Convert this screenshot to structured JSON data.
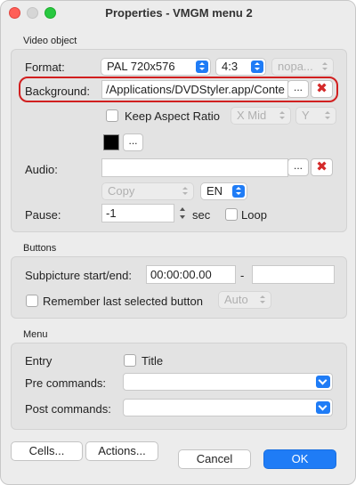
{
  "window": {
    "title": "Properties - VMGM menu 2"
  },
  "video_object": {
    "group_label": "Video object",
    "format": {
      "label": "Format:",
      "value": "PAL 720x576",
      "aspect": "4:3",
      "pan": "nopa..."
    },
    "background": {
      "label": "Background:",
      "value": "/Applications/DVDStyler.app/Conte",
      "browse": "..."
    },
    "keep_aspect": {
      "label": "Keep Aspect Ratio",
      "checked": false,
      "x_align": "X Mid",
      "y_align": "Y"
    },
    "color_browse": "...",
    "color": "#000000",
    "audio": {
      "label": "Audio:",
      "value": "",
      "browse": "...",
      "mode": "Copy",
      "language": "EN"
    },
    "pause": {
      "label": "Pause:",
      "value": "-1",
      "unit": "sec",
      "loop_label": "Loop",
      "loop_checked": false
    }
  },
  "buttons_group": {
    "group_label": "Buttons",
    "subpicture": {
      "label": "Subpicture start/end:",
      "start": "00:00:00.00",
      "separator": "-",
      "end": ""
    },
    "remember": {
      "label": "Remember last selected button",
      "checked": false,
      "value": "Auto"
    }
  },
  "menu_group": {
    "group_label": "Menu",
    "entry": {
      "label": "Entry",
      "title_label": "Title",
      "title_checked": false
    },
    "pre_commands": {
      "label": "Pre commands:",
      "value": ""
    },
    "post_commands": {
      "label": "Post commands:",
      "value": ""
    }
  },
  "footer": {
    "cells": "Cells...",
    "actions": "Actions...",
    "cancel": "Cancel",
    "ok": "OK"
  },
  "colors": {
    "accent": "#1f7cf6",
    "highlight": "#d11f1f",
    "delete": "#d42a2a"
  }
}
